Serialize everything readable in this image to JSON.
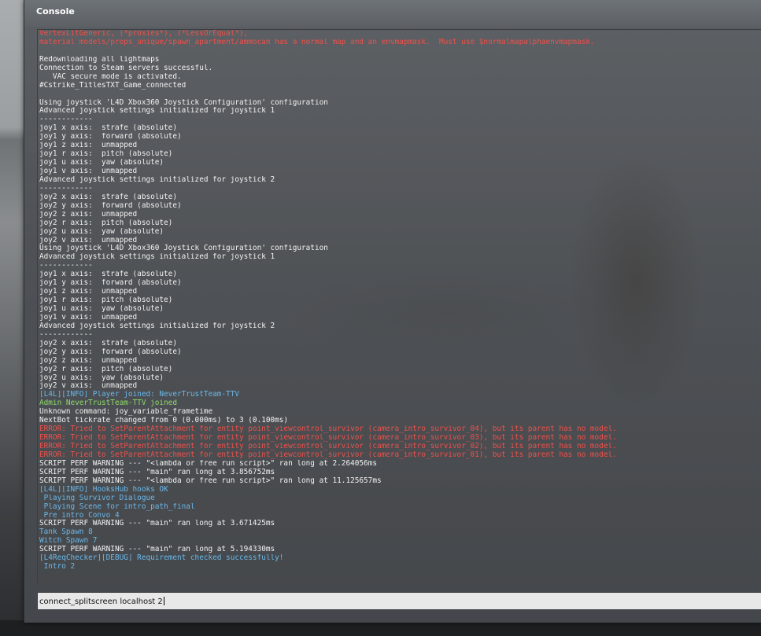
{
  "window": {
    "title": "Console"
  },
  "input": {
    "value": "connect_splitscreen localhost 2"
  },
  "colors": {
    "normal": "#f2f2f2",
    "error": "#f0504a",
    "info": "#6ab8ea",
    "admin": "#8fdc6a"
  },
  "log": [
    {
      "t": "VertexLitGeneric, (*proxies*), (*LessOrEqual*),",
      "c": "red"
    },
    {
      "t": "material models/props_unique/spawn_apartment/ammocan has a normal map and an envmapmask.  Must use $normalmapalphaenvmapmask.",
      "c": "red"
    },
    {
      "t": "",
      "c": "white"
    },
    {
      "t": "Redownloading all lightmaps",
      "c": "white"
    },
    {
      "t": "Connection to Steam servers successful.",
      "c": "white"
    },
    {
      "t": "   VAC secure mode is activated.",
      "c": "white"
    },
    {
      "t": "#Cstrike_TitlesTXT_Game_connected",
      "c": "white"
    },
    {
      "t": "",
      "c": "white"
    },
    {
      "t": "Using joystick 'L4D Xbox360 Joystick Configuration' configuration",
      "c": "white"
    },
    {
      "t": "Advanced joystick settings initialized for joystick 1",
      "c": "white"
    },
    {
      "t": "------------",
      "c": "white"
    },
    {
      "t": "joy1 x axis:  strafe (absolute)",
      "c": "white"
    },
    {
      "t": "joy1 y axis:  forward (absolute)",
      "c": "white"
    },
    {
      "t": "joy1 z axis:  unmapped",
      "c": "white"
    },
    {
      "t": "joy1 r axis:  pitch (absolute)",
      "c": "white"
    },
    {
      "t": "joy1 u axis:  yaw (absolute)",
      "c": "white"
    },
    {
      "t": "joy1 v axis:  unmapped",
      "c": "white"
    },
    {
      "t": "Advanced joystick settings initialized for joystick 2",
      "c": "white"
    },
    {
      "t": "------------",
      "c": "white"
    },
    {
      "t": "joy2 x axis:  strafe (absolute)",
      "c": "white"
    },
    {
      "t": "joy2 y axis:  forward (absolute)",
      "c": "white"
    },
    {
      "t": "joy2 z axis:  unmapped",
      "c": "white"
    },
    {
      "t": "joy2 r axis:  pitch (absolute)",
      "c": "white"
    },
    {
      "t": "joy2 u axis:  yaw (absolute)",
      "c": "white"
    },
    {
      "t": "joy2 v axis:  unmapped",
      "c": "white"
    },
    {
      "t": "Using joystick 'L4D Xbox360 Joystick Configuration' configuration",
      "c": "white"
    },
    {
      "t": "Advanced joystick settings initialized for joystick 1",
      "c": "white"
    },
    {
      "t": "------------",
      "c": "white"
    },
    {
      "t": "joy1 x axis:  strafe (absolute)",
      "c": "white"
    },
    {
      "t": "joy1 y axis:  forward (absolute)",
      "c": "white"
    },
    {
      "t": "joy1 z axis:  unmapped",
      "c": "white"
    },
    {
      "t": "joy1 r axis:  pitch (absolute)",
      "c": "white"
    },
    {
      "t": "joy1 u axis:  yaw (absolute)",
      "c": "white"
    },
    {
      "t": "joy1 v axis:  unmapped",
      "c": "white"
    },
    {
      "t": "Advanced joystick settings initialized for joystick 2",
      "c": "white"
    },
    {
      "t": "------------",
      "c": "white"
    },
    {
      "t": "joy2 x axis:  strafe (absolute)",
      "c": "white"
    },
    {
      "t": "joy2 y axis:  forward (absolute)",
      "c": "white"
    },
    {
      "t": "joy2 z axis:  unmapped",
      "c": "white"
    },
    {
      "t": "joy2 r axis:  pitch (absolute)",
      "c": "white"
    },
    {
      "t": "joy2 u axis:  yaw (absolute)",
      "c": "white"
    },
    {
      "t": "joy2 v axis:  unmapped",
      "c": "white"
    },
    {
      "t": "[L4L][INFO] Player joined: NeverTrustTeam-TTV",
      "c": "blue"
    },
    {
      "t": "Admin NeverTrustTeam-TTV joined",
      "c": "green"
    },
    {
      "t": "Unknown command: joy_variable_frametime",
      "c": "white"
    },
    {
      "t": "NextBot tickrate changed from 0 (0.000ms) to 3 (0.100ms)",
      "c": "white"
    },
    {
      "t": "ERROR: Tried to SetParentAttachment for entity point_viewcontrol_survivor (camera_intro_survivor_04), but its parent has no model.",
      "c": "red"
    },
    {
      "t": "ERROR: Tried to SetParentAttachment for entity point_viewcontrol_survivor (camera_intro_survivor_03), but its parent has no model.",
      "c": "red"
    },
    {
      "t": "ERROR: Tried to SetParentAttachment for entity point_viewcontrol_survivor (camera_intro_survivor_02), but its parent has no model.",
      "c": "red"
    },
    {
      "t": "ERROR: Tried to SetParentAttachment for entity point_viewcontrol_survivor (camera_intro_survivor_01), but its parent has no model.",
      "c": "red"
    },
    {
      "t": "SCRIPT PERF WARNING --- \"<lambda or free run script>\" ran long at 2.264056ms",
      "c": "white"
    },
    {
      "t": "SCRIPT PERF WARNING --- \"main\" ran long at 3.856752ms",
      "c": "white"
    },
    {
      "t": "SCRIPT PERF WARNING --- \"<lambda or free run script>\" ran long at 11.125657ms",
      "c": "white"
    },
    {
      "t": "[L4L][INFO] HooksHub hooks OK",
      "c": "blue"
    },
    {
      "t": " Playing Survivor Dialogue",
      "c": "blue"
    },
    {
      "t": " Playing Scene for intro_path_final",
      "c": "blue"
    },
    {
      "t": " Pre intro Convo 4",
      "c": "blue"
    },
    {
      "t": "SCRIPT PERF WARNING --- \"main\" ran long at 3.671425ms",
      "c": "white"
    },
    {
      "t": "Tank Spawn 8",
      "c": "blue"
    },
    {
      "t": "Witch Spawn 7",
      "c": "blue"
    },
    {
      "t": "SCRIPT PERF WARNING --- \"main\" ran long at 5.194330ms",
      "c": "white"
    },
    {
      "t": "[L4ReqChecker][DEBUG] Requirement checked successfully!",
      "c": "blue"
    },
    {
      "t": " Intro 2",
      "c": "blue"
    }
  ]
}
